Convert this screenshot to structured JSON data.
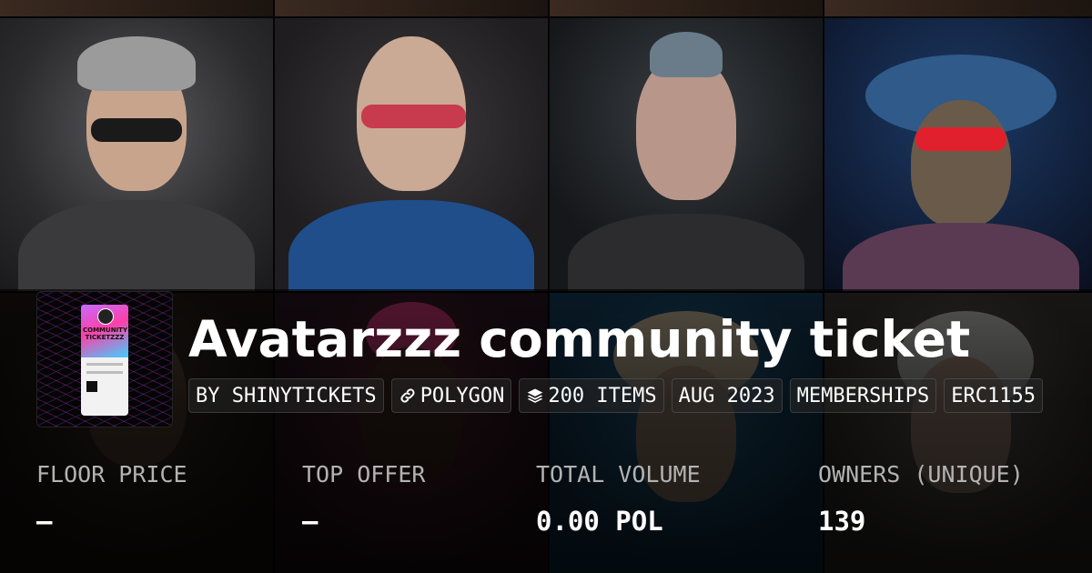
{
  "collection": {
    "title": "Avatarzzz community ticket",
    "thumbnail_text": "COMMUNITY TICKETZZZ"
  },
  "tags": [
    {
      "label": "BY SHINYTICKETS",
      "icon": ""
    },
    {
      "label": "POLYGON",
      "icon": "link-icon"
    },
    {
      "label": "200 ITEMS",
      "icon": "layers-icon"
    },
    {
      "label": "AUG 2023",
      "icon": ""
    },
    {
      "label": "MEMBERSHIPS",
      "icon": ""
    },
    {
      "label": "ERC1155",
      "icon": ""
    }
  ],
  "stats": [
    {
      "label": "FLOOR PRICE",
      "value": "–"
    },
    {
      "label": "TOP OFFER",
      "value": "–"
    },
    {
      "label": "TOTAL VOLUME",
      "value": "0.00 POL"
    },
    {
      "label": "OWNERS (UNIQUE)",
      "value": "139"
    }
  ],
  "colors": {
    "background": "#0b0b0b",
    "text": "#ffffff",
    "label": "#b3b3b3"
  }
}
